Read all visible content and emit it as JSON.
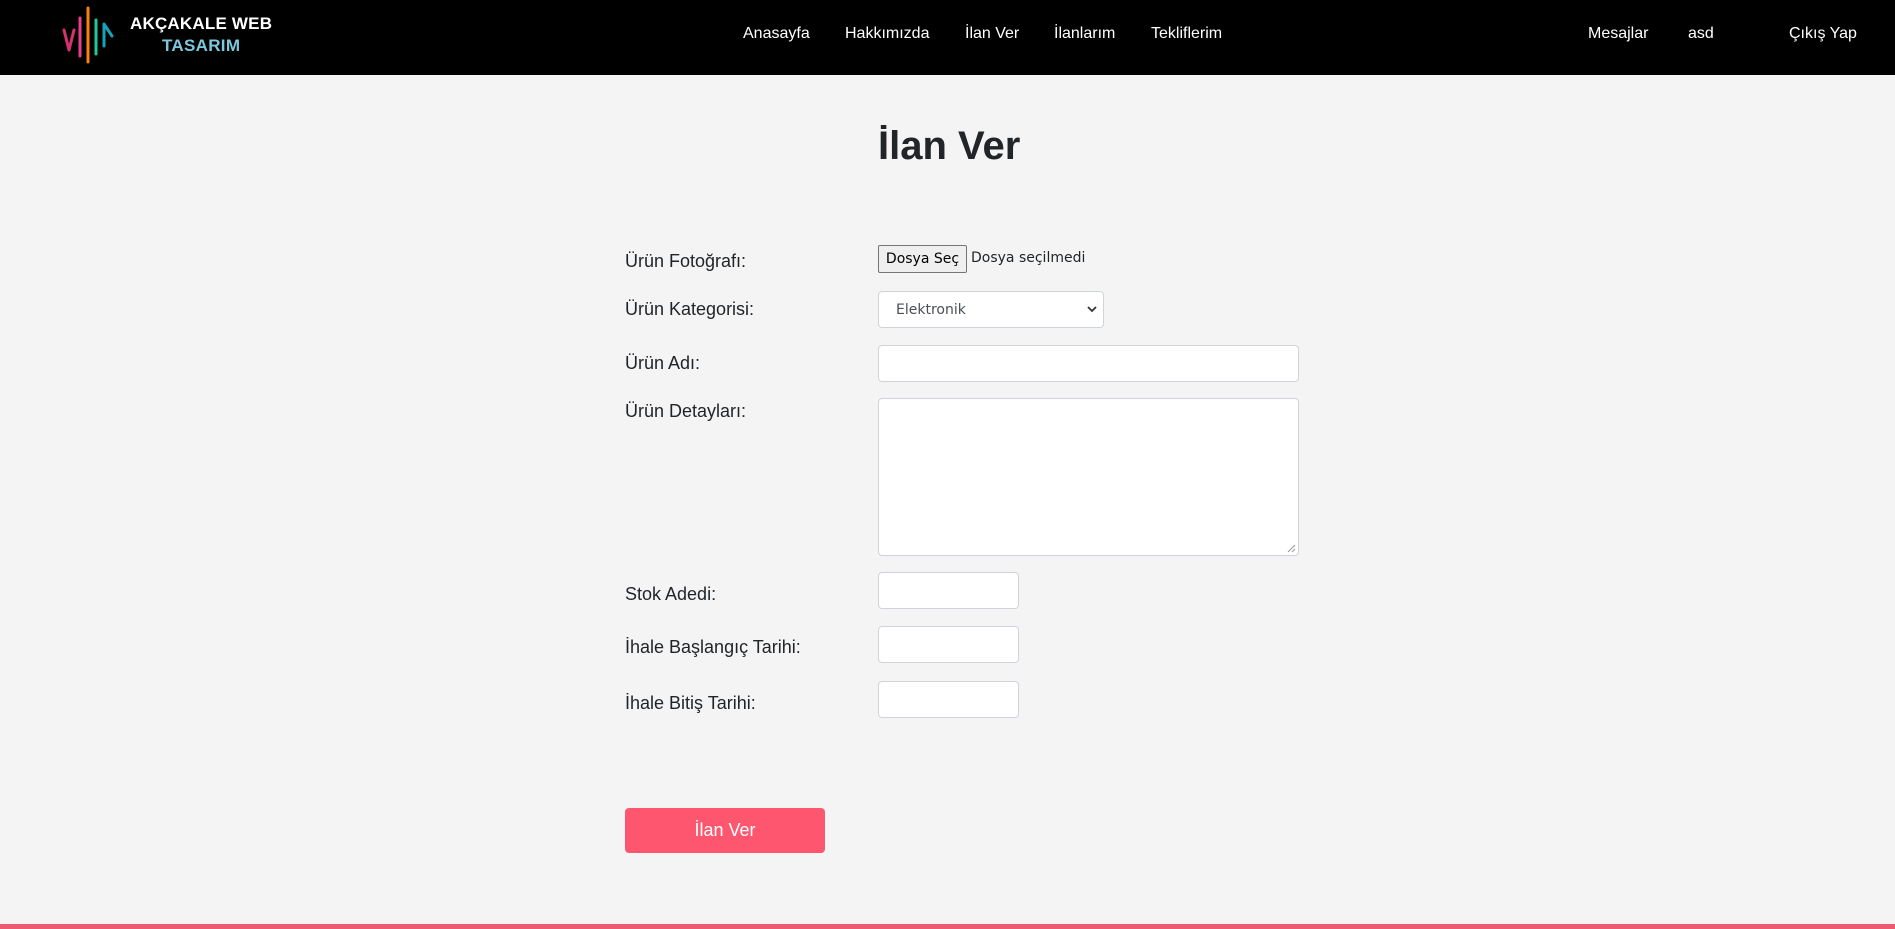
{
  "brand": {
    "line1": "AKÇAKALE WEB",
    "line2": "TASARIM",
    "bar_colors": [
      "#d6336c",
      "#e83e8c",
      "#fd7e14",
      "#20c997",
      "#17a2b8",
      "#6f42c1"
    ]
  },
  "nav": {
    "items": [
      "Anasayfa",
      "Hakkımızda",
      "İlan Ver",
      "İlanlarım",
      "Tekliflerim"
    ],
    "right": [
      "Mesajlar",
      "asd",
      "Çıkış Yap"
    ]
  },
  "page": {
    "title": "İlan Ver"
  },
  "form": {
    "photo_label": "Ürün Fotoğrafı:",
    "file_button": "Dosya Seç",
    "file_status": "Dosya seçilmedi",
    "category_label": "Ürün Kategorisi:",
    "category_value": "Elektronik",
    "name_label": "Ürün Adı:",
    "name_value": "",
    "details_label": "Ürün Detayları:",
    "details_value": "",
    "stock_label": "Stok Adedi:",
    "stock_value": "",
    "start_label": "İhale Başlangıç Tarihi:",
    "start_value": "",
    "end_label": "İhale Bitiş Tarihi:",
    "end_value": "",
    "submit": "İlan Ver"
  },
  "colors": {
    "navbar_bg": "#000000",
    "page_bg": "#f4f4f4",
    "accent": "#ff5670"
  }
}
